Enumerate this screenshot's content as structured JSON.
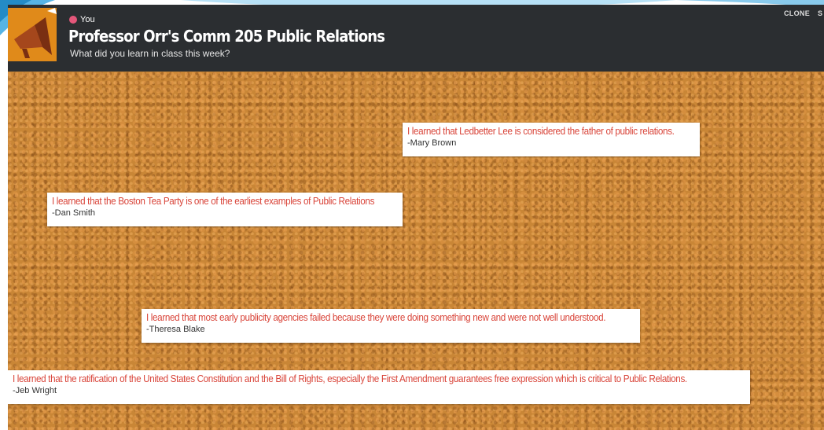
{
  "header": {
    "author": "You",
    "title": "Professor Orr's Comm 205 Public Relations",
    "subtitle": "What did you learn in class this week?",
    "clone_label": "CLONE",
    "share_label_partial": "S"
  },
  "posts": [
    {
      "text": "I learned that Ledbetter Lee is considered the father of public relations.",
      "author": "-Mary Brown"
    },
    {
      "text": "I learned that the Boston Tea Party is one of the earliest examples of Public Relations",
      "author": "-Dan Smith"
    },
    {
      "text": "I learned that most early publicity agencies failed because they were doing something new and were not well understood.",
      "author": "-Theresa Blake"
    },
    {
      "text": "I learned that the ratification of the United States Constitution and the Bill of Rights, especially the First Amendment guarantees free expression which is critical to Public Relations.",
      "author": "-Jeb Wright"
    }
  ],
  "colors": {
    "header_bg": "#2b2e31",
    "cork": "#c98636",
    "note_text": "#d9453a",
    "logo": "#e08a1a",
    "slide_accent": "#3aa7e0"
  },
  "icons": {
    "logo": "megaphone-icon",
    "avatar": "avatar"
  }
}
